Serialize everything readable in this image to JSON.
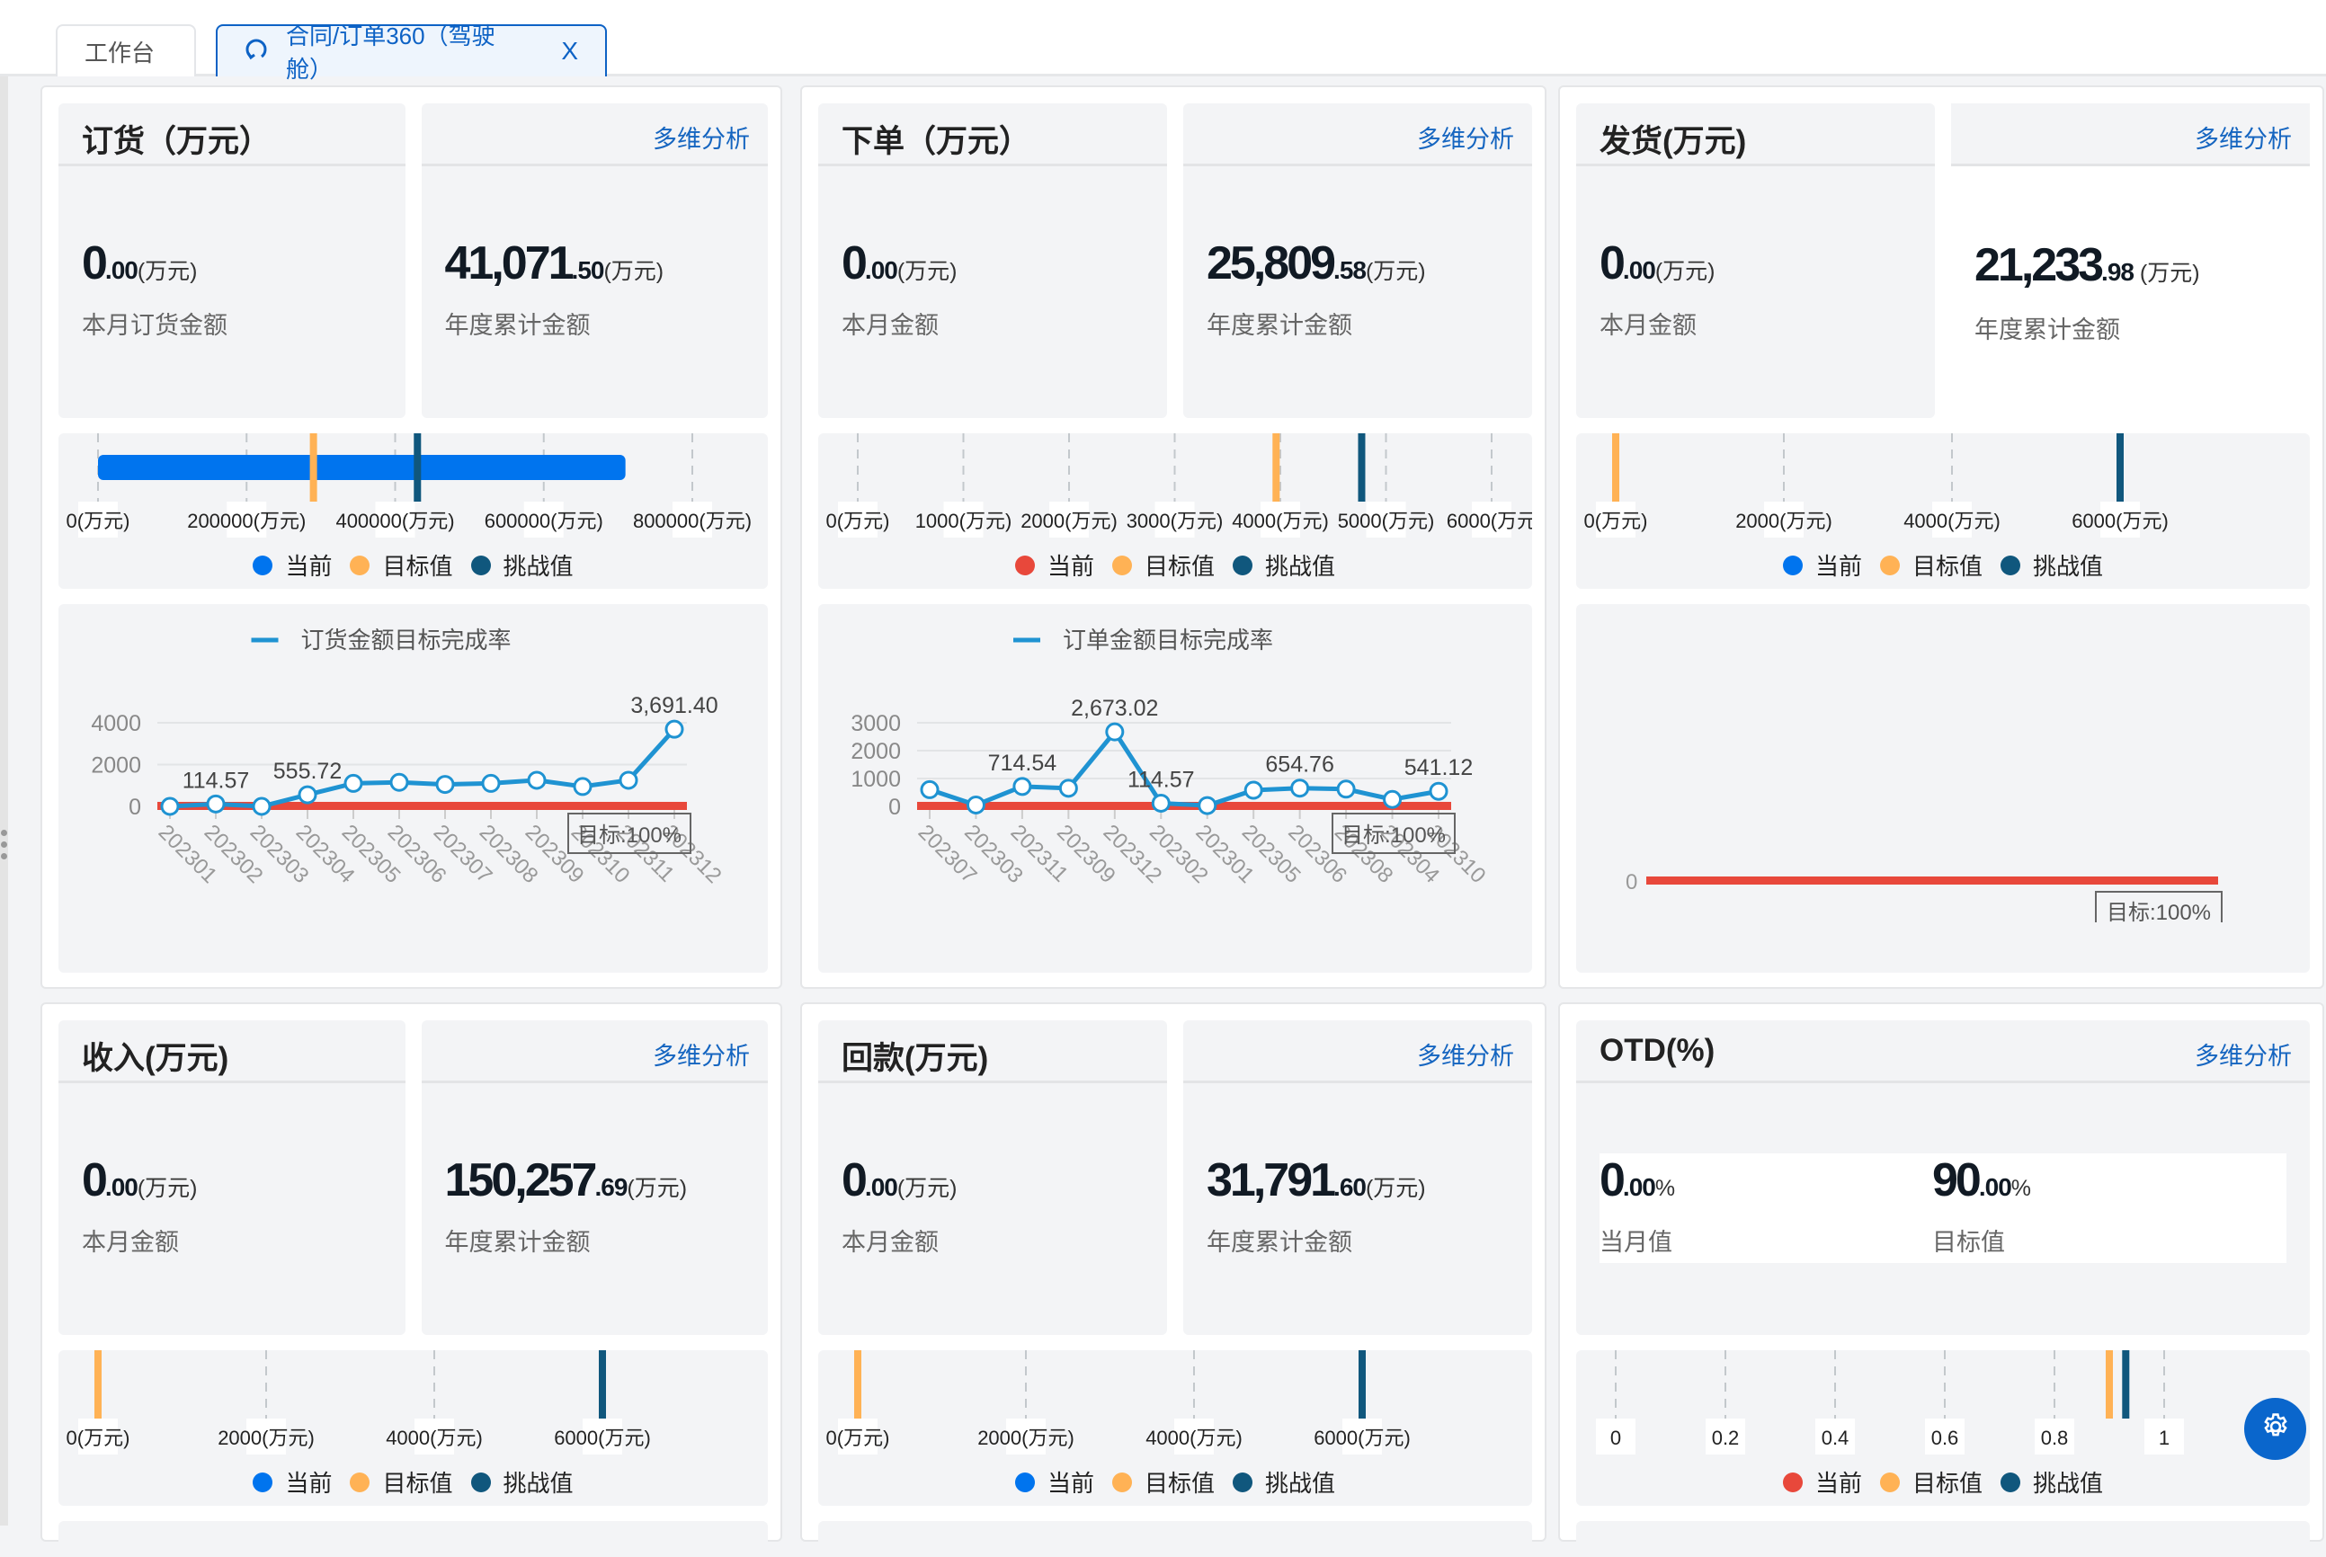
{
  "tabs": [
    {
      "label": "工作台",
      "active": false
    },
    {
      "label": "合同/订单360（驾驶舱）",
      "active": true,
      "icon": "refresh-icon",
      "close": "X"
    }
  ],
  "common": {
    "link_label": "多维分析",
    "legend": [
      "当前",
      "目标值",
      "挑战值"
    ]
  },
  "colors": {
    "current_blue": "#0074ee",
    "current_red": "#e8483b",
    "target": "#ffb255",
    "challenge": "#10577d",
    "line": "#1f93d2",
    "target_line": "#e8483b",
    "link": "#1565c0"
  },
  "panels": [
    {
      "id": "order",
      "title": "订货（万元）",
      "month": {
        "int": "0",
        "dec": ".00",
        "unit": "(万元)",
        "label": "本月订货金额"
      },
      "year": {
        "int": "41,071",
        "dec": ".50",
        "unit": "(万元)",
        "label": "年度累计金额"
      }
    },
    {
      "id": "placed",
      "title": "下单（万元）",
      "month": {
        "int": "0",
        "dec": ".00",
        "unit": "(万元)",
        "label": "本月金额"
      },
      "year": {
        "int": "25,809",
        "dec": ".58",
        "unit": "(万元)",
        "label": "年度累计金额"
      }
    },
    {
      "id": "ship",
      "title": "发货(万元)",
      "month": {
        "int": "0",
        "dec": ".00",
        "unit": "(万元)",
        "label": "本月金额"
      },
      "year": {
        "int": "21,233",
        "dec": ".98",
        "unit": " (万元)",
        "label": "年度累计金额"
      }
    },
    {
      "id": "income",
      "title": "收入(万元)",
      "month": {
        "int": "0",
        "dec": ".00",
        "unit": "(万元)",
        "label": "本月金额"
      },
      "year": {
        "int": "150,257",
        "dec": ".69",
        "unit": "(万元)",
        "label": "年度累计金额"
      }
    },
    {
      "id": "payment",
      "title": "回款(万元)",
      "month": {
        "int": "0",
        "dec": ".00",
        "unit": "(万元)",
        "label": "本月金额"
      },
      "year": {
        "int": "31,791",
        "dec": ".60",
        "unit": "(万元)",
        "label": "年度累计金额"
      }
    },
    {
      "id": "otd",
      "title": "OTD(%)",
      "month": {
        "int": "0",
        "dec": ".00",
        "unit": "%",
        "label": "当月值"
      },
      "year": {
        "int": "90",
        "dec": ".00",
        "unit": "%",
        "label": "目标值"
      }
    }
  ],
  "chart_data": [
    {
      "type": "bullet",
      "panel": "order",
      "ticks": [
        "0(万元)",
        "200000(万元)",
        "400000(万元)",
        "600000(万元)",
        "800000(万元)"
      ],
      "range": [
        0,
        800000
      ],
      "tick_values": [
        0,
        200000,
        400000,
        600000,
        800000
      ],
      "current": 710000,
      "target": 290000,
      "challenge": 430000,
      "current_color": "blue",
      "legend": [
        "当前",
        "目标值",
        "挑战值"
      ]
    },
    {
      "type": "bullet",
      "panel": "placed",
      "ticks": [
        "0(万元)",
        "1000(万元)",
        "2000(万元)",
        "3000(万元)",
        "4000(万元)",
        "5000(万元)",
        "6000(万元"
      ],
      "range": [
        0,
        6000
      ],
      "tick_values": [
        0,
        1000,
        2000,
        3000,
        4000,
        5000,
        6000
      ],
      "current": 0,
      "target": 3960,
      "challenge": 4770,
      "current_color": "red",
      "legend": [
        "当前",
        "目标值",
        "挑战值"
      ]
    },
    {
      "type": "bullet",
      "panel": "ship",
      "ticks": [
        "0(万元)",
        "2000(万元)",
        "4000(万元)",
        "6000(万元)"
      ],
      "range": [
        0,
        8000
      ],
      "tick_values": [
        0,
        2000,
        4000,
        6000
      ],
      "current": 0,
      "target": 0,
      "challenge": 6000,
      "current_color": "blue",
      "legend": [
        "当前",
        "目标值",
        "挑战值"
      ]
    },
    {
      "type": "bullet",
      "panel": "income",
      "ticks": [
        "0(万元)",
        "2000(万元)",
        "4000(万元)",
        "6000(万元)"
      ],
      "range": [
        0,
        8000
      ],
      "tick_values": [
        0,
        2000,
        4000,
        6000
      ],
      "current": 0,
      "target": 0,
      "challenge": 6000,
      "current_color": "blue",
      "legend": [
        "当前",
        "目标值",
        "挑战值"
      ]
    },
    {
      "type": "bullet",
      "panel": "payment",
      "ticks": [
        "0(万元)",
        "2000(万元)",
        "4000(万元)",
        "6000(万元)"
      ],
      "range": [
        0,
        8000
      ],
      "tick_values": [
        0,
        2000,
        4000,
        6000
      ],
      "current": 0,
      "target": 0,
      "challenge": 6000,
      "current_color": "blue",
      "legend": [
        "当前",
        "目标值",
        "挑战值"
      ]
    },
    {
      "type": "bullet",
      "panel": "otd",
      "ticks": [
        "0",
        "0.2",
        "0.4",
        "0.6",
        "0.8",
        "1"
      ],
      "range": [
        0,
        1.2
      ],
      "tick_values": [
        0,
        0.2,
        0.4,
        0.6,
        0.8,
        1
      ],
      "current": 0,
      "target": 0.9,
      "challenge": 0.93,
      "current_color": "red",
      "legend": [
        "当前",
        "目标值",
        "挑战值"
      ]
    },
    {
      "type": "line",
      "panel": "order",
      "legend": "订货金额目标完成率",
      "categories": [
        "202301",
        "202302",
        "202303",
        "202304",
        "202305",
        "202306",
        "202307",
        "202308",
        "202309",
        "202310",
        "202311",
        "202312"
      ],
      "values": [
        0,
        114.57,
        0,
        555.72,
        1100,
        1150,
        1050,
        1100,
        1250,
        950,
        1250,
        3691.4
      ],
      "labels": {
        "1": "114.57",
        "3": "555.72",
        "11": "3,691.40"
      },
      "yticks": [
        0,
        2000,
        4000
      ],
      "ylim": [
        0,
        4000
      ],
      "target_label": "目标:100%",
      "target_value": 0
    },
    {
      "type": "line",
      "panel": "placed",
      "legend": "订单金额目标完成率",
      "categories": [
        "202307",
        "202303",
        "202311",
        "202309",
        "202312",
        "202302",
        "202301",
        "202305",
        "202306",
        "202308",
        "202304",
        "202310"
      ],
      "values": [
        600,
        50,
        714.54,
        650,
        2673.02,
        114.57,
        30,
        580,
        654.76,
        620,
        250,
        541.12
      ],
      "labels": {
        "2": "714.54",
        "4": "2,673.02",
        "5": "114.57",
        "8": "654.76",
        "11": "541.12"
      },
      "yticks": [
        0,
        1000,
        2000,
        3000
      ],
      "ylim": [
        0,
        3000
      ],
      "target_label": "目标:100%",
      "target_value": 0
    },
    {
      "type": "line",
      "panel": "ship",
      "legend": "",
      "categories": [],
      "values": [],
      "labels": {},
      "yticks": [
        0
      ],
      "ylim": [
        0,
        0
      ],
      "target_label": "目标:100%",
      "target_value": 0
    }
  ],
  "fab": {
    "icon": "gear-icon"
  }
}
